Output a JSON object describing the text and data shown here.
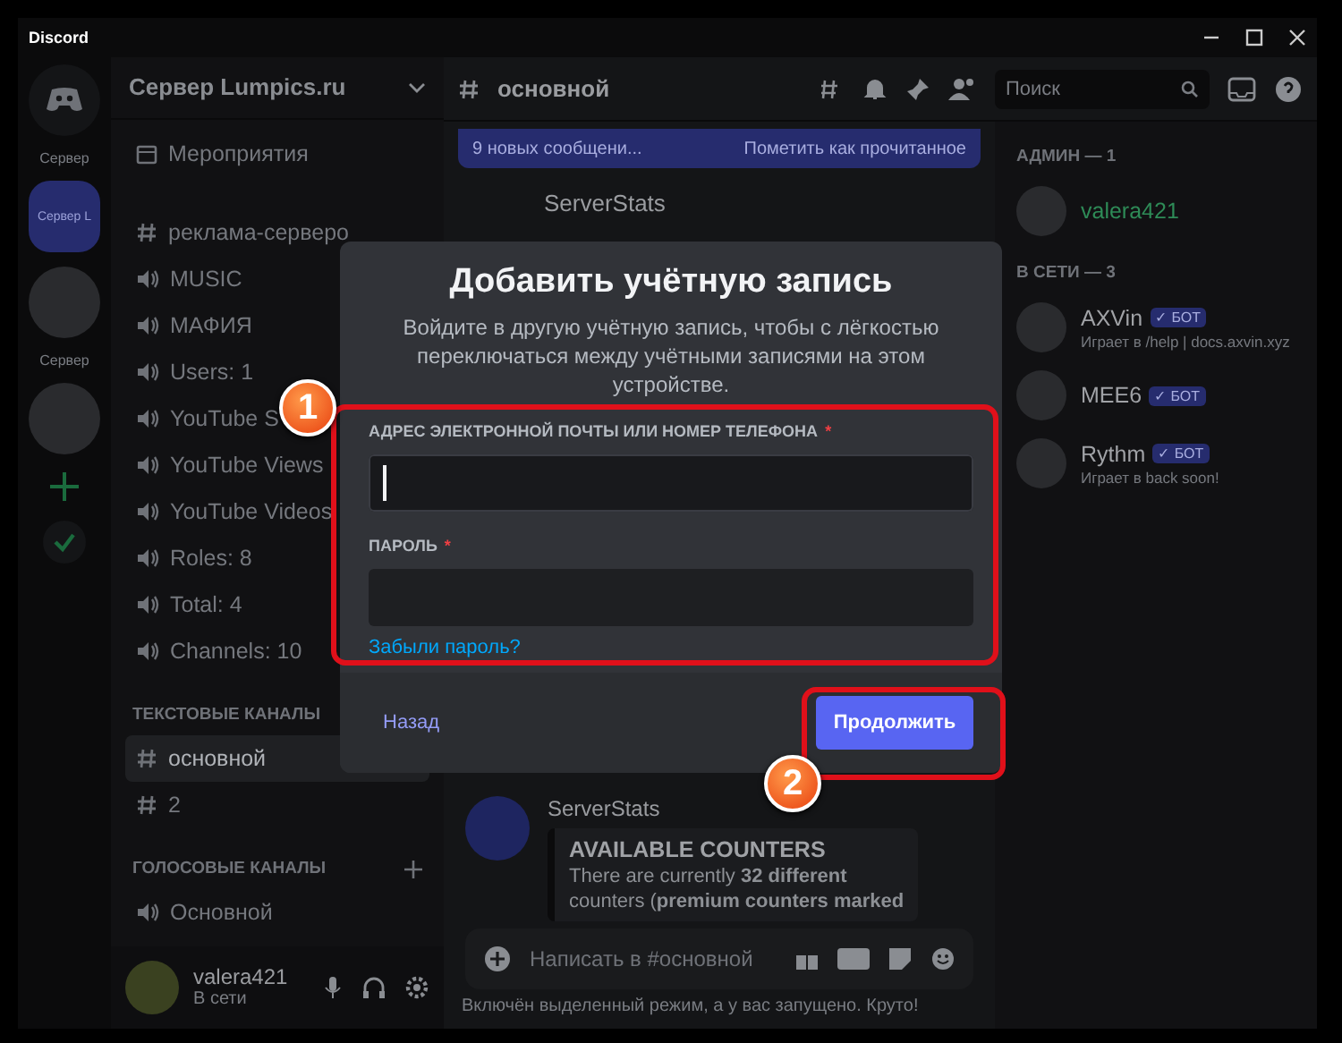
{
  "window": {
    "title": "Discord"
  },
  "server_rail": [
    {
      "kind": "home",
      "selected": false
    },
    {
      "kind": "folder_label",
      "label": "Сервер",
      "selected": false
    },
    {
      "kind": "server",
      "label": "Сервер L",
      "selected": true
    },
    {
      "kind": "avatar",
      "selected": false
    },
    {
      "kind": "folder_label",
      "label": "Сервер",
      "selected": false
    },
    {
      "kind": "avatar",
      "selected": false
    },
    {
      "kind": "add",
      "selected": false
    },
    {
      "kind": "explore",
      "selected": false
    }
  ],
  "channels": {
    "server_name": "Сервер Lumpics.ru",
    "items": [
      {
        "kind": "event",
        "name": "Мероприятия",
        "selected": false
      },
      {
        "kind": "text",
        "name": "реклама-серверо",
        "selected": false
      },
      {
        "kind": "voice",
        "name": "MUSIC",
        "selected": false
      },
      {
        "kind": "voice",
        "name": "МАФИЯ",
        "selected": false
      },
      {
        "kind": "voice",
        "name": "Users: 1",
        "selected": false
      },
      {
        "kind": "voice",
        "name": "YouTube S",
        "selected": false
      },
      {
        "kind": "voice",
        "name": "YouTube Views",
        "selected": false
      },
      {
        "kind": "voice",
        "name": "YouTube Videos",
        "selected": false
      },
      {
        "kind": "voice",
        "name": "Roles: 8",
        "selected": false
      },
      {
        "kind": "voice",
        "name": "Total: 4",
        "selected": false
      },
      {
        "kind": "voice",
        "name": "Channels: 10",
        "selected": false
      },
      {
        "kind": "category",
        "name": "ТЕКСТОВЫЕ КАНАЛЫ"
      },
      {
        "kind": "text",
        "name": "основной",
        "selected": true
      },
      {
        "kind": "text",
        "name": "2",
        "selected": false
      },
      {
        "kind": "category",
        "name": "ГОЛОСОВЫЕ КАНАЛЫ"
      },
      {
        "kind": "voice",
        "name": "Основной",
        "selected": false
      }
    ]
  },
  "user_panel": {
    "name": "valera421",
    "status": "В сети"
  },
  "chat": {
    "channel": "основной",
    "search_placeholder": "Поиск",
    "banner": {
      "text": "9 новых сообщени...",
      "action": "Пометить как прочитанное"
    },
    "author": "ServerStats",
    "author_2": "ServerStats",
    "embed": {
      "title": "AVAILABLE COUNTERS",
      "lines": [
        "There are currently **32 different**",
        "counters (**premium counters marked**"
      ]
    },
    "composer_placeholder": "Написать в #основной",
    "footer_note": "Включён выделенный режим, а у вас запущено. Круто!"
  },
  "members": [
    {
      "title": "АДМИН — 1",
      "members": [
        {
          "name": "valera421",
          "color": "#2e8b57"
        }
      ]
    },
    {
      "title": "В СЕТИ — 3",
      "members": [
        {
          "name": "AXVin",
          "tag": "✓ БОТ",
          "activity": "Играет в /help | docs.axvin.xyz",
          "color": "#a0a2a6"
        },
        {
          "name": "MEE6",
          "tag": "✓ БОТ",
          "color": "#a0a2a6"
        },
        {
          "name": "Rythm",
          "tag": "✓ БОТ",
          "activity": "Играет в back soon!",
          "color": "#a0a2a6"
        }
      ]
    }
  ],
  "modal": {
    "title": "Добавить учётную запись",
    "description": "Войдите в другую учётную запись, чтобы с лёгкостью переключаться между учётными записями на этом устройстве.",
    "fields": [
      {
        "label": "АДРЕС ЭЛЕКТРОННОЙ ПОЧТЫ ИЛИ НОМЕР ТЕЛЕФОНА",
        "required_mark": "*",
        "focused": true
      },
      {
        "label": "ПАРОЛЬ",
        "required_mark": "*",
        "focused": false
      }
    ],
    "forgot_link": "Забыли пароль?",
    "back": "Назад",
    "continue": "Продолжить"
  },
  "annotations": [
    {
      "number": "1"
    },
    {
      "number": "2"
    }
  ]
}
